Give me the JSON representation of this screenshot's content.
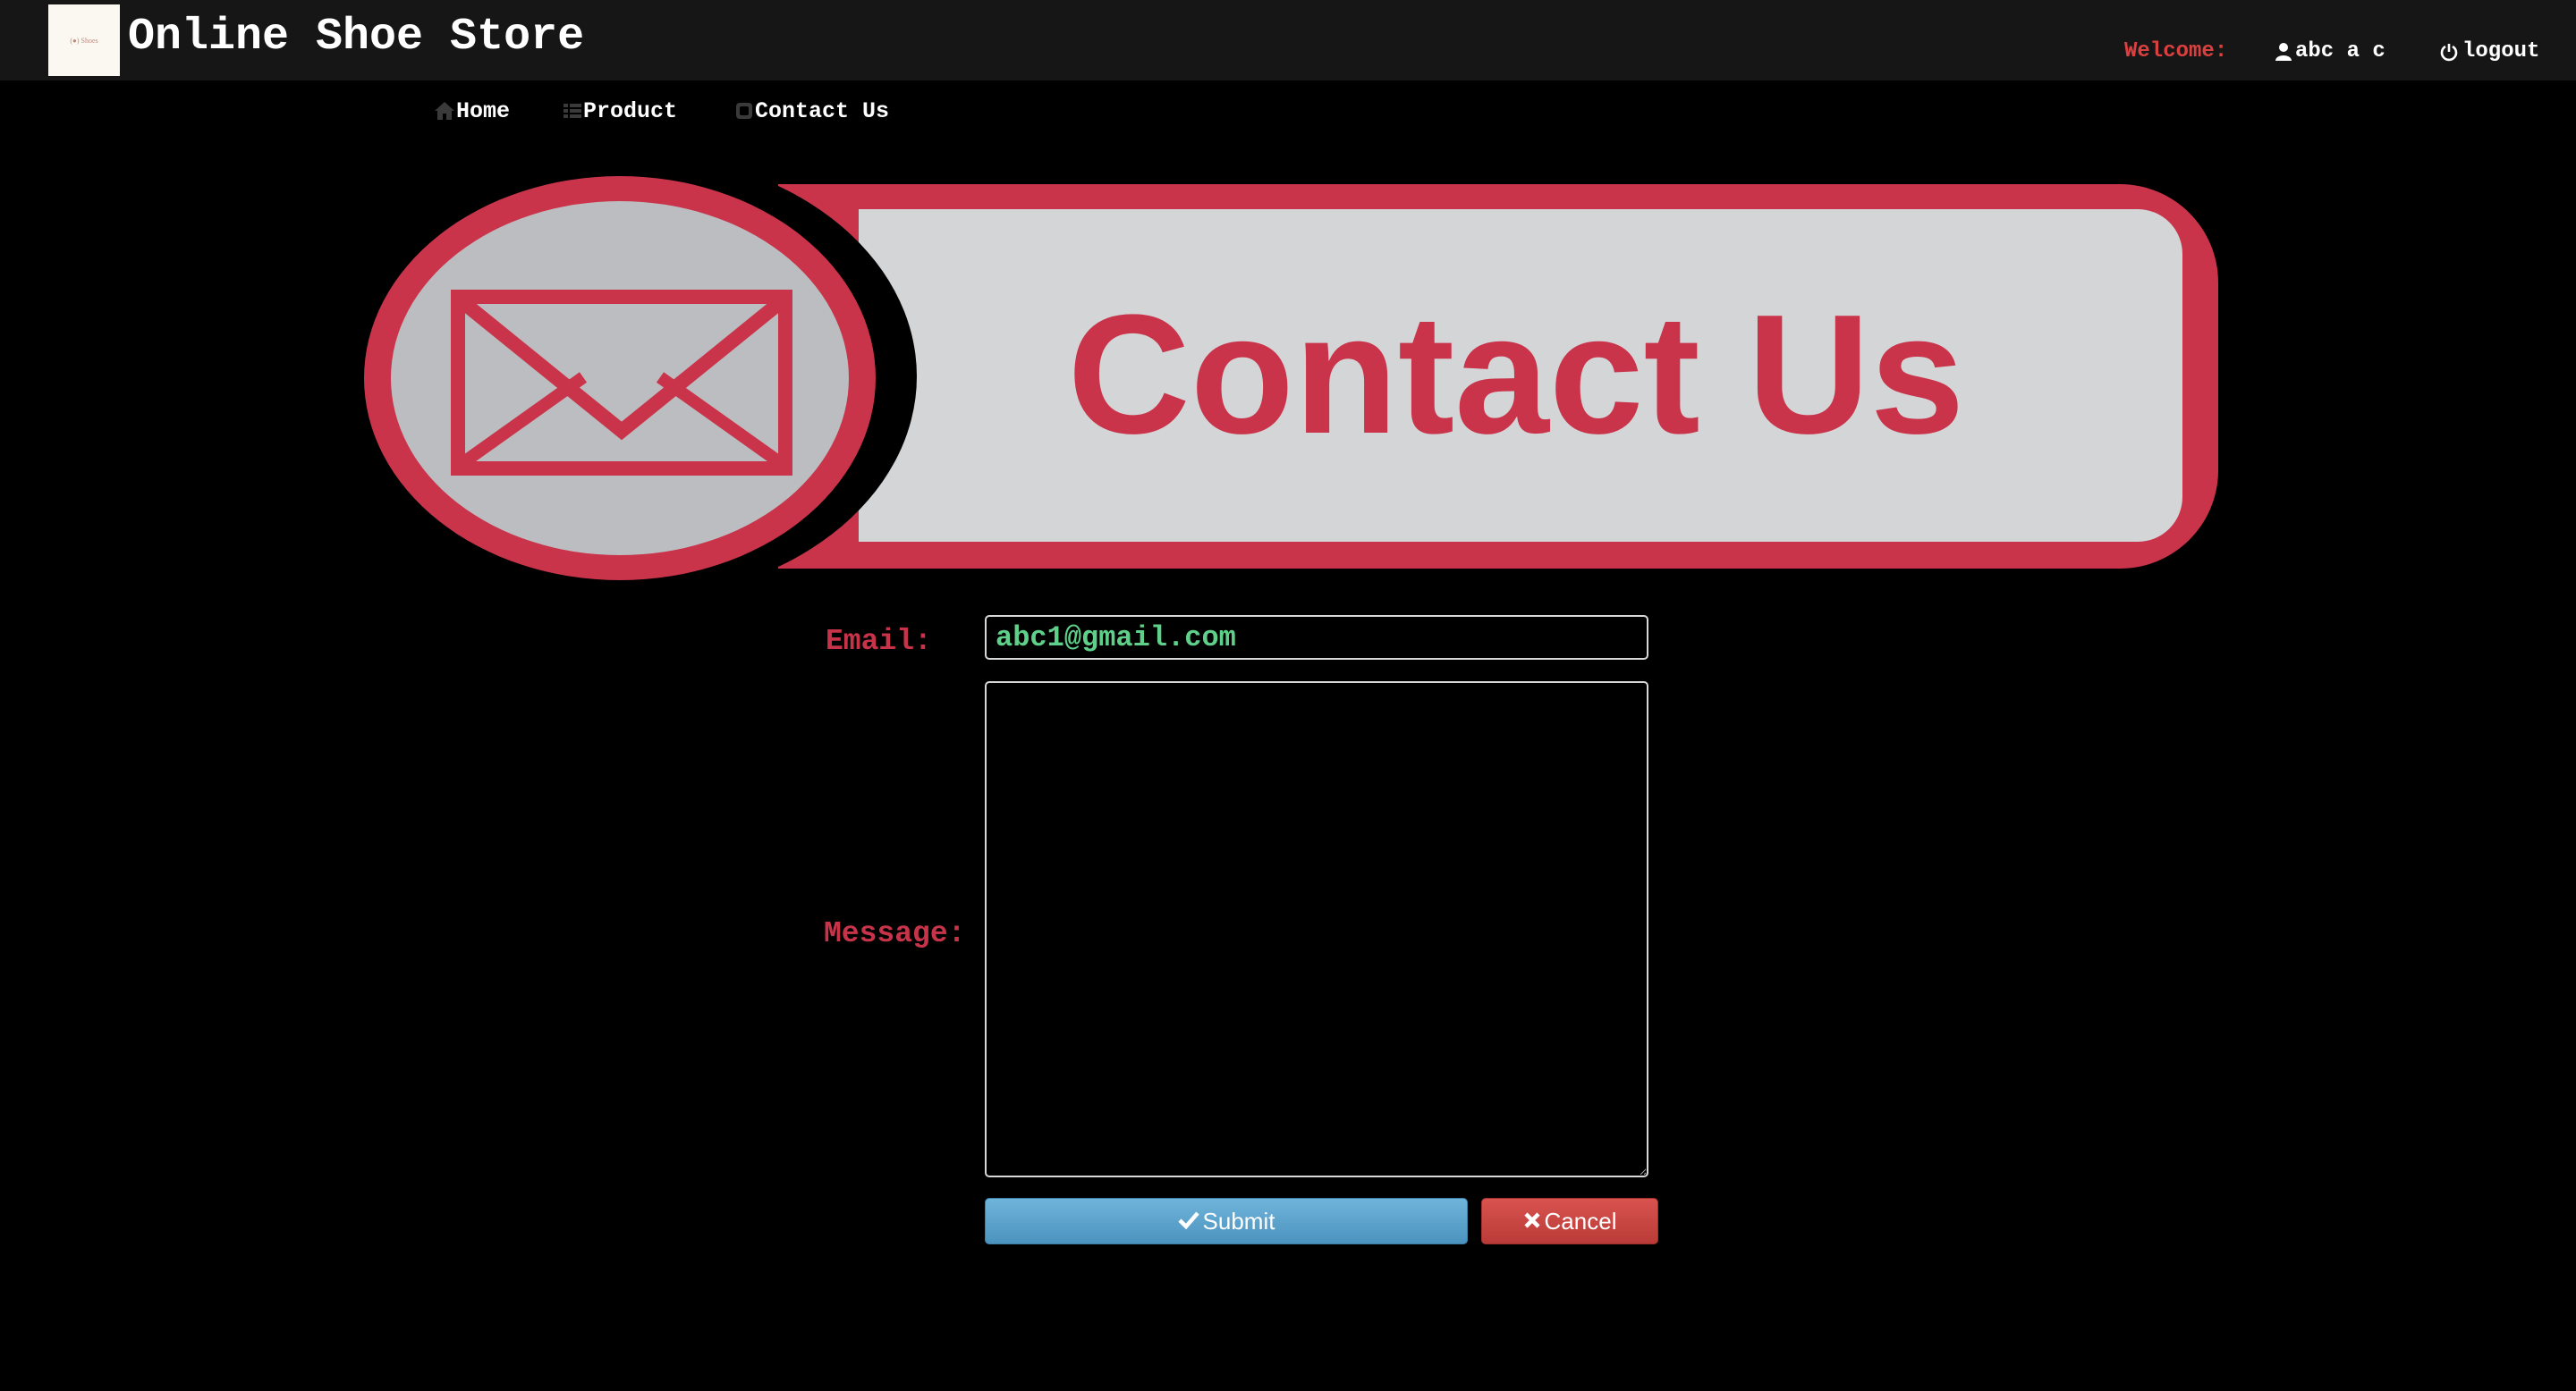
{
  "header": {
    "logo_text": "(●) Shoes",
    "brand": "Online Shoe Store",
    "welcome_label": "Welcome:",
    "user_name": "abc a c",
    "logout_label": "logout"
  },
  "nav": {
    "items": [
      {
        "label": "Home",
        "icon": "home-icon"
      },
      {
        "label": "Product",
        "icon": "grid-icon"
      },
      {
        "label": "Contact Us",
        "icon": "phone-icon"
      }
    ]
  },
  "banner": {
    "text": "Contact Us",
    "icon": "envelope-icon",
    "colors": {
      "accent": "#c9344a",
      "panel": "#d4d5d7"
    }
  },
  "form": {
    "email_label": "Email:",
    "email_value": "abc1@gmail.com",
    "message_label": "Message:",
    "message_value": "",
    "submit_label": "Submit",
    "cancel_label": "Cancel"
  },
  "colors": {
    "label": "#c7344a",
    "input_text": "#5fd08a",
    "welcome": "#d9403f",
    "submit": "#5ba3cd",
    "cancel": "#d0463f"
  }
}
